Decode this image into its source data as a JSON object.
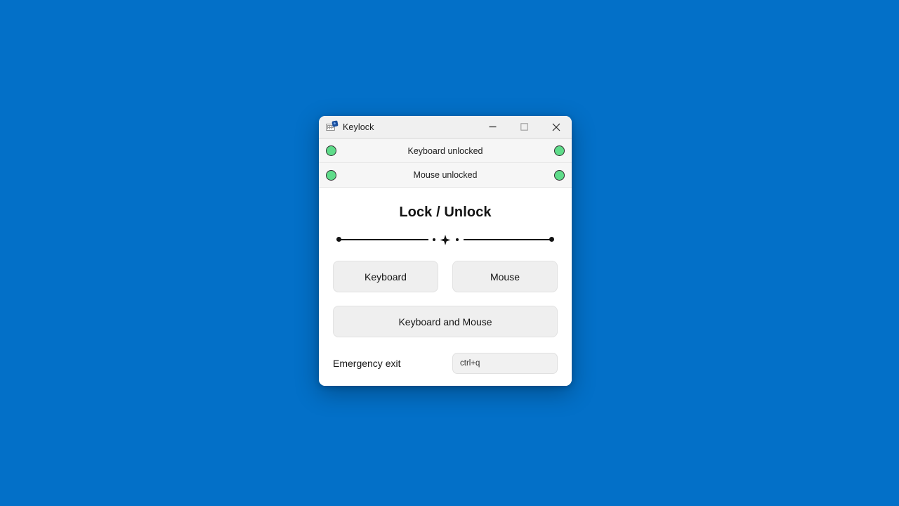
{
  "desktop": {
    "background_color": "#0370c8"
  },
  "window": {
    "title": "Keylock",
    "icon": "keyboard-lock-icon",
    "controls": {
      "minimize_label": "Minimize",
      "maximize_label": "Maximize",
      "close_label": "Close"
    }
  },
  "status": {
    "rows": [
      {
        "label": "Keyboard unlocked",
        "led_left": "#5fdc8a",
        "led_right": "#5fdc8a",
        "state": "unlocked"
      },
      {
        "label": "Mouse unlocked",
        "led_left": "#5fdc8a",
        "led_right": "#5fdc8a",
        "state": "unlocked"
      }
    ]
  },
  "main": {
    "heading": "Lock / Unlock",
    "divider": "ornamental-diamond-divider",
    "buttons": {
      "keyboard": "Keyboard",
      "mouse": "Mouse",
      "keyboard_and_mouse": "Keyboard and Mouse"
    },
    "emergency": {
      "label": "Emergency exit",
      "value": "ctrl+q",
      "placeholder": "ctrl+q"
    }
  }
}
